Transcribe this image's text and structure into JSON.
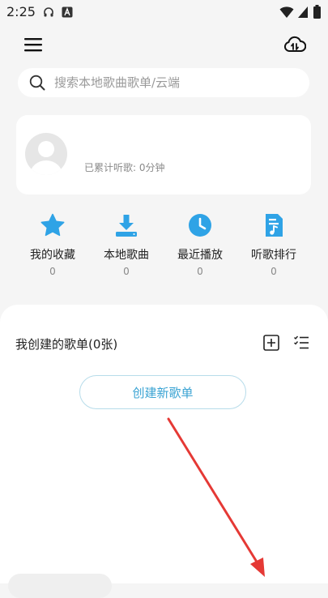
{
  "status_bar": {
    "time": "2:25"
  },
  "search": {
    "placeholder": "搜索本地歌曲歌单/云端"
  },
  "profile": {
    "listen_time": "已累计听歌: 0分钟"
  },
  "quick_actions": [
    {
      "label": "我的收藏",
      "count": "0",
      "icon": "star-icon"
    },
    {
      "label": "本地歌曲",
      "count": "0",
      "icon": "download-icon"
    },
    {
      "label": "最近播放",
      "count": "0",
      "icon": "clock-icon"
    },
    {
      "label": "听歌排行",
      "count": "0",
      "icon": "ranking-icon"
    }
  ],
  "playlists": {
    "title": "我创建的歌单(0张)",
    "create_label": "创建新歌单"
  },
  "colors": {
    "accent": "#2fa3e6",
    "arrow": "#e53935"
  }
}
